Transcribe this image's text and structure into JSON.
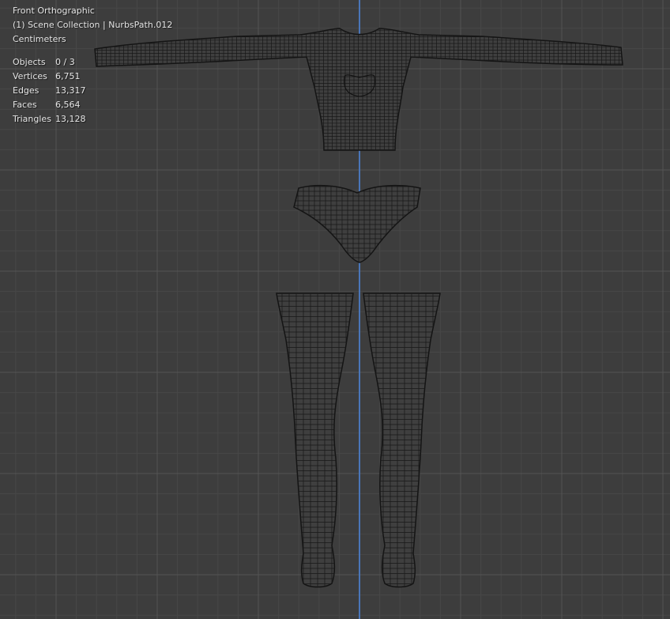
{
  "viewport": {
    "view_name": "Front Orthographic",
    "collection_line": "(1) Scene Collection | NurbsPath.012",
    "units": "Centimeters"
  },
  "stats": [
    {
      "label": "Objects",
      "value": "0 / 3"
    },
    {
      "label": "Vertices",
      "value": "6,751"
    },
    {
      "label": "Edges",
      "value": "13,317"
    },
    {
      "label": "Faces",
      "value": "6,564"
    },
    {
      "label": "Triangles",
      "value": "13,128"
    }
  ],
  "colors": {
    "background": "#3d3d3d",
    "grid_major": "#545454",
    "grid_minor": "#474747",
    "z_axis": "#4a76b8",
    "wire": "#141414",
    "mesh_fill": "#3f3f3f",
    "overlay_text": "#e6e6e6"
  },
  "objects": [
    {
      "name": "sweater"
    },
    {
      "name": "panties"
    },
    {
      "name": "stocking-left"
    },
    {
      "name": "stocking-right"
    }
  ]
}
